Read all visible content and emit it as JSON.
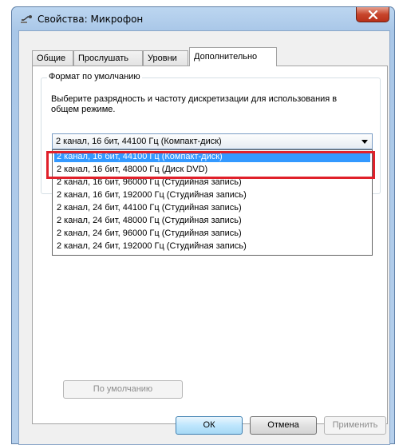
{
  "window": {
    "title": "Свойства: Микрофон",
    "icon": "microphone-icon",
    "close": "close-icon"
  },
  "tabs": [
    {
      "label": "Общие",
      "active": false
    },
    {
      "label": "Прослушать",
      "active": false
    },
    {
      "label": "Уровни",
      "active": false
    },
    {
      "label": "Дополнительно",
      "active": true
    }
  ],
  "default_format": {
    "legend": "Формат по умолчанию",
    "description": "Выберите разрядность и частоту дискретизации для использования в общем режиме.",
    "selected": "2 канал, 16 бит, 44100 Гц (Компакт-диск)",
    "options": [
      "2 канал, 16 бит, 44100 Гц (Компакт-диск)",
      "2 канал, 16 бит, 48000 Гц (Диск DVD)",
      "2 канал, 16 бит, 96000 Гц (Студийная запись)",
      "2 канал, 16 бит, 192000 Гц (Студийная запись)",
      "2 канал, 24 бит, 44100 Гц (Студийная запись)",
      "2 канал, 24 бит, 48000 Гц (Студийная запись)",
      "2 канал, 24 бит, 96000 Гц (Студийная запись)",
      "2 канал, 24 бит, 192000 Гц (Студийная запись)"
    ],
    "highlighted_index": 0
  },
  "buttons": {
    "default": "По умолчанию",
    "ok": "ОК",
    "cancel": "Отмена",
    "apply": "Применить"
  },
  "colors": {
    "selection": "#3399ff",
    "annotation": "#e0202a"
  }
}
